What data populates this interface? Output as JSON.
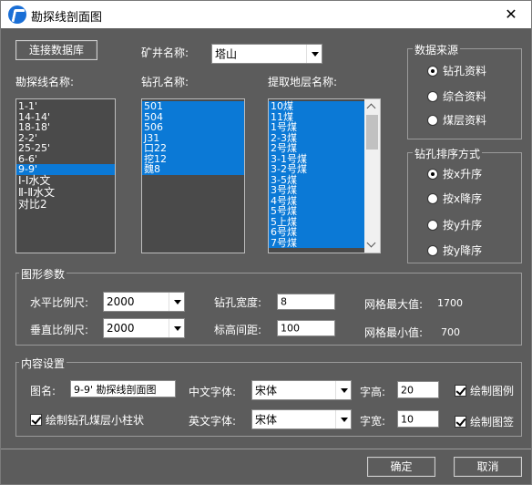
{
  "window": {
    "title": "勘探线剖面图",
    "close": "✕"
  },
  "top": {
    "connect_btn": "连接数据库",
    "mine_label": "矿井名称:",
    "mine_value": "塔山"
  },
  "lists": {
    "line_label": "勘探线名称:",
    "line_items": [
      "1-1'",
      "14-14'",
      "18-18'",
      "2-2'",
      "25-25'",
      "6-6'",
      "9-9'",
      "Ⅰ-Ⅰ水文",
      "Ⅱ-Ⅱ水文",
      "对比2"
    ],
    "hole_label": "钻孔名称:",
    "hole_items": [
      "501",
      "504",
      "506",
      "J31",
      "口22",
      "挖12",
      "魏8"
    ],
    "layer_label": "提取地层名称:",
    "layer_items": [
      "10煤",
      "11煤",
      "1号煤",
      "2-3煤",
      "2号煤",
      "3-1号煤",
      "3-2号煤",
      "3-5煤",
      "3号煤",
      "4号煤",
      "5号煤",
      "5上煤",
      "6号煤",
      "7号煤"
    ]
  },
  "source": {
    "title": "数据来源",
    "options": [
      "钻孔资料",
      "综合资料",
      "煤层资料"
    ]
  },
  "sort": {
    "title": "钻孔排序方式",
    "options": [
      "按x升序",
      "按x降序",
      "按y升序",
      "按y降序"
    ]
  },
  "graph": {
    "title": "图形参数",
    "h_scale_label": "水平比例尺:",
    "h_scale_value": "2000",
    "v_scale_label": "垂直比例尺:",
    "v_scale_value": "2000",
    "hole_width_label": "钻孔宽度:",
    "hole_width_value": "8",
    "elev_interval_label": "标高间距:",
    "elev_interval_value": "100",
    "grid_max_label": "网格最大值:",
    "grid_max_value": "1700",
    "grid_min_label": "网格最小值:",
    "grid_min_value": "700"
  },
  "content": {
    "title": "内容设置",
    "name_label": "图名:",
    "name_value": "9-9' 勘探线剖面图",
    "cn_font_label": "中文字体:",
    "cn_font_value": "宋体",
    "en_font_label": "英文字体:",
    "en_font_value": "宋体",
    "char_h_label": "字高:",
    "char_h_value": "20",
    "char_w_label": "字宽:",
    "char_w_value": "10",
    "draw_legend": "绘制图例",
    "draw_sign": "绘制图签",
    "draw_column": "绘制钻孔煤层小柱状"
  },
  "footer": {
    "ok": "确定",
    "cancel": "取消"
  }
}
